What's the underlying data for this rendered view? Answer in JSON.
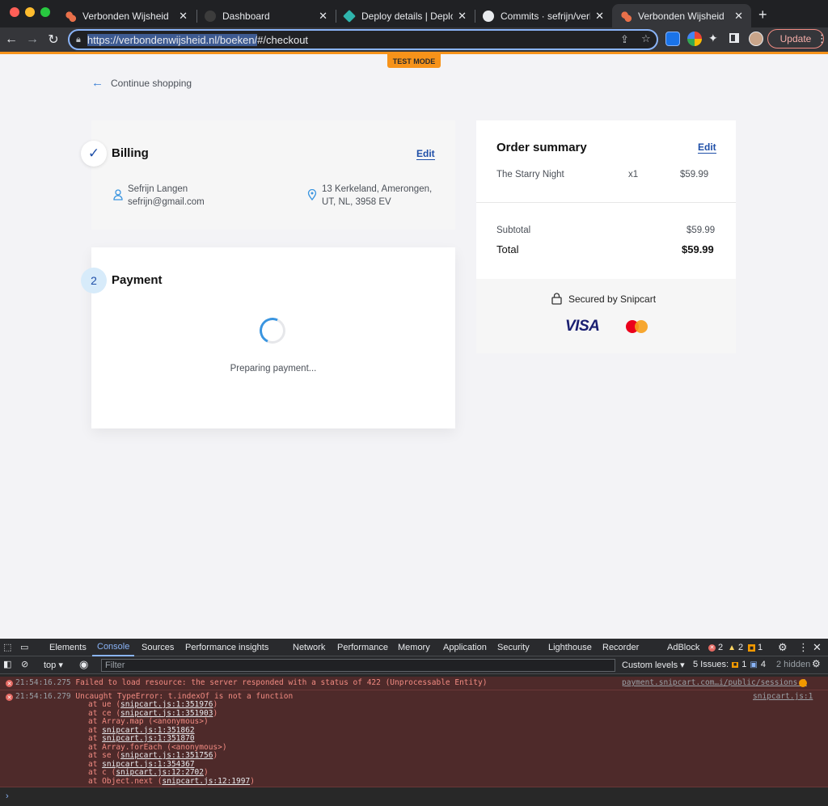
{
  "browser": {
    "tabs": [
      {
        "title": "Verbonden Wijsheid",
        "active": false
      },
      {
        "title": "Dashboard",
        "active": false
      },
      {
        "title": "Deploy details | Deploys |",
        "active": false
      },
      {
        "title": "Commits · sefrijn/verbond",
        "active": false
      },
      {
        "title": "Verbonden Wijsheid",
        "active": true
      }
    ],
    "url_selected": "https://verbondenwijsheid.nl/boeken/",
    "url_rest": "#/checkout",
    "update_label": "Update"
  },
  "page": {
    "test_mode": "TEST MODE",
    "continue_shopping": "Continue shopping",
    "billing": {
      "step": "✓",
      "title": "Billing",
      "edit": "Edit",
      "name": "Sefrijn Langen",
      "email": "sefrijn@gmail.com",
      "address_line1": "13 Kerkeland, Amerongen,",
      "address_line2": "UT, NL, 3958 EV"
    },
    "payment": {
      "step": "2",
      "title": "Payment",
      "status": "Preparing payment..."
    },
    "summary": {
      "title": "Order summary",
      "edit": "Edit",
      "item_name": "The Starry Night",
      "item_qty": "x1",
      "item_price": "$59.99",
      "subtotal_label": "Subtotal",
      "subtotal_value": "$59.99",
      "total_label": "Total",
      "total_value": "$59.99",
      "secured": "Secured by Snipcart",
      "visa": "VISA"
    }
  },
  "devtools": {
    "tabs": [
      "Elements",
      "Console",
      "Sources",
      "Performance insights",
      "Network",
      "Performance",
      "Memory",
      "Application",
      "Security",
      "Lighthouse",
      "Recorder",
      "AdBlock"
    ],
    "active_tab": "Console",
    "errors_count": "2",
    "warnings_count": "2",
    "info_count": "1",
    "context": "top",
    "filter_placeholder": "Filter",
    "levels": "Custom levels ▾",
    "issues_label": "5 Issues:",
    "issues_warn": "1",
    "issues_info": "4",
    "hidden": "2 hidden",
    "log1": {
      "time": "21:54:16.275",
      "message": "Failed to load resource: the server responded with a status of 422 (Unprocessable Entity)",
      "source": "payment.snipcart.com…i/public/sessions:1"
    },
    "log2": {
      "time": "21:54:16.279",
      "message": "Uncaught TypeError: t.indexOf is not a function",
      "source": "snipcart.js:1",
      "stack": [
        {
          "pre": "at ue (",
          "link": "snipcart.js:1:351976",
          "post": ")"
        },
        {
          "pre": "at ce (",
          "link": "snipcart.js:1:351903",
          "post": ")"
        },
        {
          "pre": "at Array.map (<anonymous>)",
          "link": "",
          "post": ""
        },
        {
          "pre": "at ",
          "link": "snipcart.js:1:351862",
          "post": ""
        },
        {
          "pre": "at ",
          "link": "snipcart.js:1:351870",
          "post": ""
        },
        {
          "pre": "at Array.forEach (<anonymous>)",
          "link": "",
          "post": ""
        },
        {
          "pre": "at se (",
          "link": "snipcart.js:1:351756",
          "post": ")"
        },
        {
          "pre": "at ",
          "link": "snipcart.js:1:354367",
          "post": ""
        },
        {
          "pre": "at c (",
          "link": "snipcart.js:12:2702",
          "post": ")"
        },
        {
          "pre": "at Object.next (",
          "link": "snipcart.js:12:1997",
          "post": ")"
        }
      ]
    },
    "prompt": "›"
  }
}
